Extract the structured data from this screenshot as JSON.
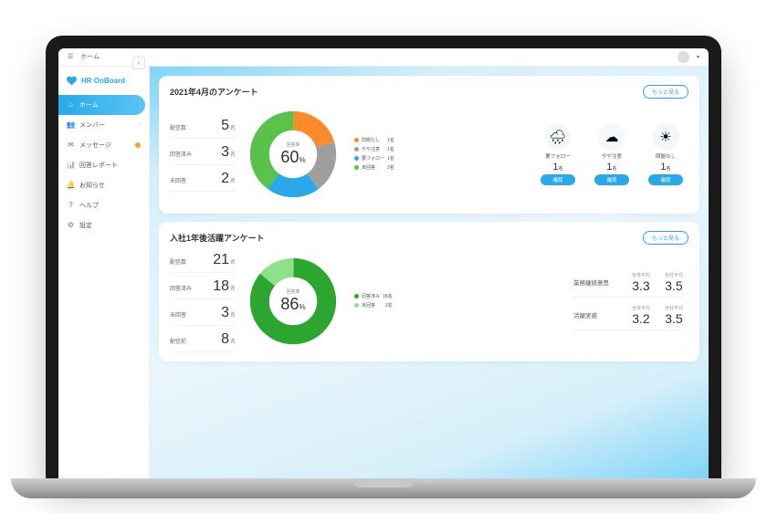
{
  "topbar": {
    "title": "ホーム"
  },
  "brand": "HR OnBoard",
  "sidebar": {
    "items": [
      {
        "label": "ホーム"
      },
      {
        "label": "メンバー"
      },
      {
        "label": "メッセージ"
      },
      {
        "label": "回答レポート"
      },
      {
        "label": "お知らせ"
      },
      {
        "label": "ヘルプ"
      },
      {
        "label": "設定"
      }
    ]
  },
  "survey1": {
    "title": "2021年4月のアンケート",
    "more": "もっと見る",
    "stats": [
      {
        "label": "配信数",
        "value": 5,
        "unit": "名"
      },
      {
        "label": "回答済み",
        "value": 3,
        "unit": "名"
      },
      {
        "label": "未回答",
        "value": 2,
        "unit": "名"
      }
    ],
    "donut": {
      "centerLabel": "回答率",
      "value": 60,
      "unit": "%"
    },
    "legend": [
      {
        "label": "問題なし",
        "value": "1名",
        "color": "#ff8a2b"
      },
      {
        "label": "やや注意",
        "value": "1名",
        "color": "#9e9e9e"
      },
      {
        "label": "要フォロー",
        "value": "1名",
        "color": "#2aa8e8"
      },
      {
        "label": "未回答",
        "value": "2名",
        "color": "#59c24a"
      }
    ],
    "statuses": [
      {
        "name": "要フォロー",
        "count": 1,
        "unit": "名",
        "icon": "🌧",
        "btn": "確認"
      },
      {
        "name": "やや注意",
        "count": 1,
        "unit": "名",
        "icon": "☁",
        "btn": "確認"
      },
      {
        "name": "問題なし",
        "count": 1,
        "unit": "名",
        "icon": "☀",
        "btn": "確認"
      }
    ]
  },
  "survey2": {
    "title": "入社1年後活躍アンケート",
    "more": "もっと見る",
    "stats": [
      {
        "label": "配信数",
        "value": 21,
        "unit": "名"
      },
      {
        "label": "回答済み",
        "value": 18,
        "unit": "名"
      },
      {
        "label": "未回答",
        "value": 3,
        "unit": "名"
      },
      {
        "label": "配信前",
        "value": 8,
        "unit": "名"
      }
    ],
    "donut": {
      "centerLabel": "回答率",
      "value": 86,
      "unit": "%"
    },
    "legend": [
      {
        "label": "回答済み",
        "value": "18名",
        "color": "#2ca630"
      },
      {
        "label": "未回答",
        "value": "3名",
        "color": "#8fe08a"
      }
    ],
    "metrics": [
      {
        "name": "業務継続意思",
        "cols": [
          {
            "label": "全体平均",
            "value": "3.3"
          },
          {
            "label": "自社平均",
            "value": "3.5"
          }
        ]
      },
      {
        "name": "活躍実感",
        "cols": [
          {
            "label": "全体平均",
            "value": "3.2"
          },
          {
            "label": "自社平均",
            "value": "3.5"
          }
        ]
      }
    ]
  },
  "chart_data": [
    {
      "type": "pie",
      "title": "2021年4月のアンケート 回答率",
      "centerValue": 60,
      "series": [
        {
          "name": "問題なし",
          "value": 1,
          "color": "#ff8a2b"
        },
        {
          "name": "やや注意",
          "value": 1,
          "color": "#9e9e9e"
        },
        {
          "name": "要フォロー",
          "value": 1,
          "color": "#2aa8e8"
        },
        {
          "name": "未回答",
          "value": 2,
          "color": "#59c24a"
        }
      ]
    },
    {
      "type": "pie",
      "title": "入社1年後活躍アンケート 回答率",
      "centerValue": 86,
      "series": [
        {
          "name": "回答済み",
          "value": 18,
          "color": "#2ca630"
        },
        {
          "name": "未回答",
          "value": 3,
          "color": "#8fe08a"
        }
      ]
    }
  ]
}
